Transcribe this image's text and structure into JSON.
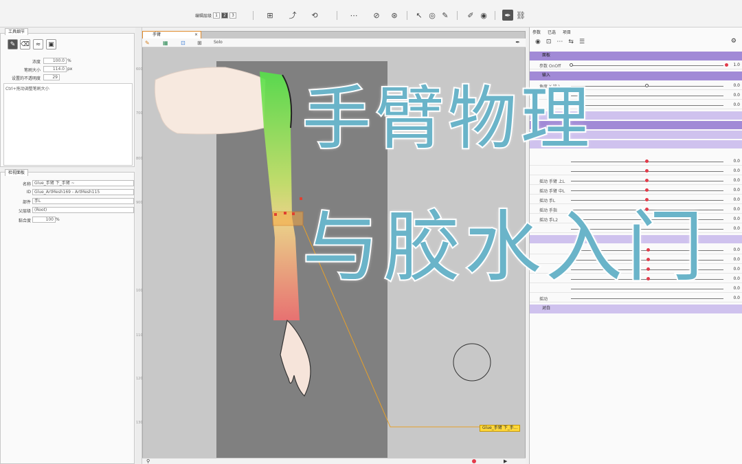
{
  "topbar": {
    "layout_label": "编辑层级",
    "layout_nums": [
      "1",
      "2",
      "3"
    ],
    "icons": [
      "deformer-tool-icon",
      "bend-tool-icon",
      "rotate-tool-icon",
      "mesh-icon",
      "glue-icon",
      "lasso-icon",
      "arrow-icon",
      "cycle-icon",
      "brush-icon",
      "pen-icon",
      "eye-icon",
      "pin-icon",
      "link-icon"
    ]
  },
  "tool_panel": {
    "tab": "工具细节",
    "opacity_label": "浓度",
    "opacity_value": "100.0",
    "opacity_unit": "%",
    "brush_size_label": "笔刷大小",
    "brush_size_value": "114.0",
    "brush_size_unit": "px",
    "transparency_label": "设置的不透明度",
    "transparency_value": "29",
    "hint": "Ctrl+拖动调整笔刷大小"
  },
  "inspector": {
    "tab": "检视面板",
    "name_label": "名称",
    "name_value": "Glue_手臂 下_手臂 ~",
    "id_label": "ID",
    "id_value": "Glue_ArtMesh169 - ArtMesh115",
    "part_label": "部件",
    "part_value": "手L",
    "parent_label": "父层级",
    "parent_value": "(Root)",
    "intensity_label": "黏合度",
    "intensity_value": "100",
    "intensity_unit": "%"
  },
  "document": {
    "tab_title": "手臂",
    "solo_label": "Solo",
    "glue_label": "Glue_手臂 下_手..."
  },
  "ruler": [
    "600",
    "700",
    "800",
    "900",
    "1000",
    "1100",
    "1200",
    "1300"
  ],
  "overlay": {
    "line1": "手臂物理",
    "line2": "与胶水入门"
  },
  "right_panel": {
    "tabs": [
      "参数",
      "已选",
      "项目"
    ],
    "groups": {
      "g1": "面板",
      "g2": "输入",
      "g3": "对白"
    },
    "params": [
      {
        "label": "参数 OnOff",
        "value": "1.0"
      },
      {
        "label": "角度 X 输入",
        "value": "0.0"
      },
      {
        "label": "",
        "value": "0.0"
      },
      {
        "label": "",
        "value": "0.0"
      },
      {
        "label": "",
        "value": "0.0"
      },
      {
        "label": "",
        "value": "0.0"
      },
      {
        "label": "摇动 手臂 上L",
        "value": "0.0"
      },
      {
        "label": "摇动 手臂 中L",
        "value": "0.0"
      },
      {
        "label": "摇动 手L",
        "value": "0.0"
      },
      {
        "label": "摇动 手指",
        "value": "0.0"
      },
      {
        "label": "摇动 手L2",
        "value": "0.0"
      },
      {
        "label": "",
        "value": "0.0"
      },
      {
        "label": "",
        "value": "0.0"
      },
      {
        "label": "",
        "value": "0.0"
      },
      {
        "label": "",
        "value": "0.0"
      },
      {
        "label": "",
        "value": "0.0"
      },
      {
        "label": "",
        "value": "0.0"
      },
      {
        "label": "摇动",
        "value": "0.0"
      }
    ]
  }
}
